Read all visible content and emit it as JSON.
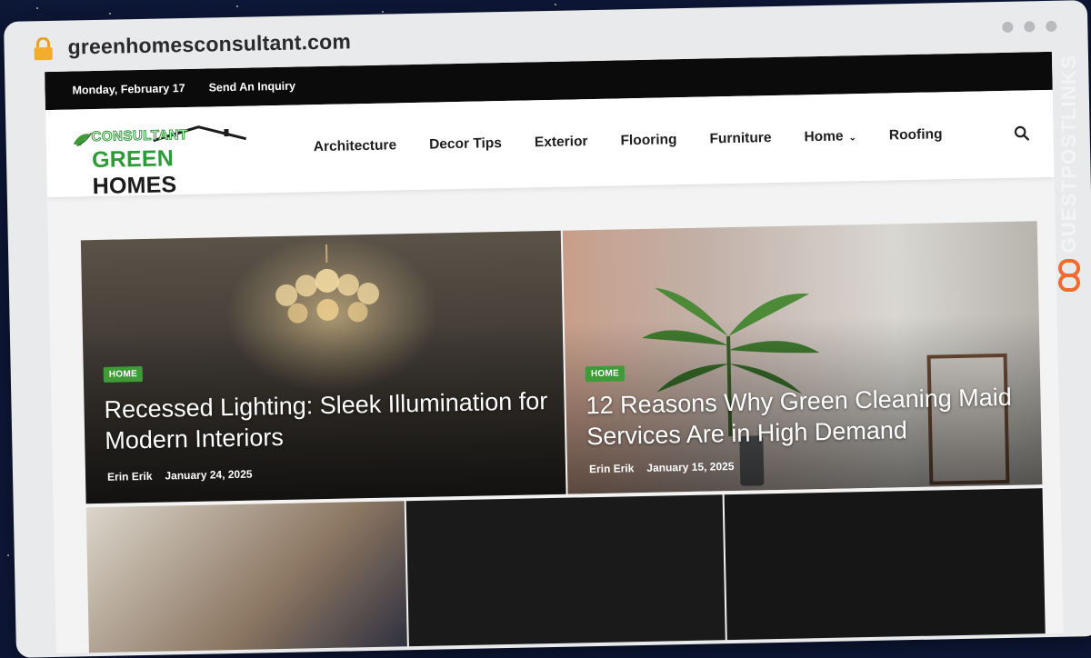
{
  "browser": {
    "url": "greenhomesconsultant.com"
  },
  "topbar": {
    "date": "Monday, February 17",
    "inquiry_link": "Send An Inquiry"
  },
  "logo": {
    "line1": "CONSULTANT",
    "line2_green": "GREEN",
    "line2_dark": "HOMES"
  },
  "nav": {
    "items": [
      "Architecture",
      "Decor Tips",
      "Exterior",
      "Flooring",
      "Furniture",
      "Home",
      "Roofing"
    ],
    "home_has_dropdown": true,
    "search_icon": "search-icon"
  },
  "featured": [
    {
      "category": "HOME",
      "title": "Recessed Lighting: Sleek Illumination for Modern Interiors",
      "author": "Erin Erik",
      "date": "January 24, 2025"
    },
    {
      "category": "HOME",
      "title": "12 Reasons Why Green Cleaning Maid Services Are in High Demand",
      "author": "Erin Erik",
      "date": "January 15, 2025"
    }
  ],
  "watermark": "GUESTPOSTLINKS",
  "colors": {
    "accent_green": "#3f9b37",
    "topbar_bg": "#0b0b0b",
    "watermark_orange": "#f26a2e"
  }
}
